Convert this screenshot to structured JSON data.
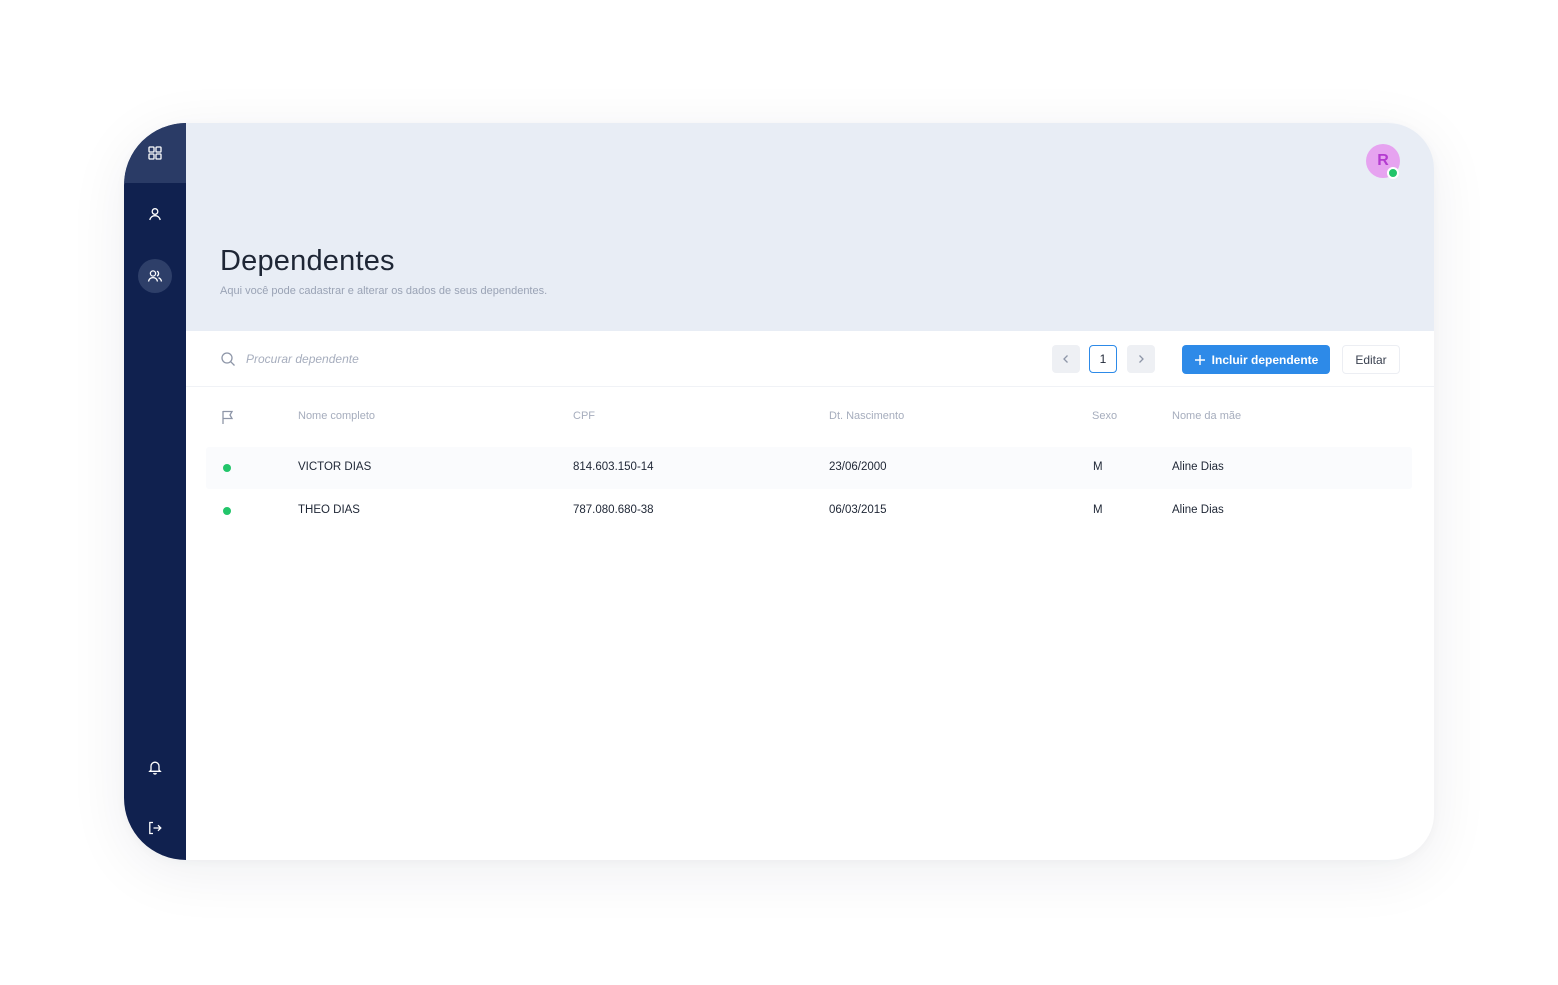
{
  "sidebar": {
    "items": [
      {
        "name": "dashboard",
        "icon": "grid-icon"
      },
      {
        "name": "profile",
        "icon": "user-icon"
      },
      {
        "name": "dependents",
        "icon": "users-icon",
        "active": true
      },
      {
        "name": "notifications",
        "icon": "bell-icon"
      },
      {
        "name": "logout",
        "icon": "logout-icon"
      }
    ]
  },
  "header": {
    "title": "Dependentes",
    "subtitle": "Aqui você pode cadastrar e alterar os dados de seus dependentes.",
    "avatar_initial": "R",
    "avatar_status": "online"
  },
  "toolbar": {
    "search_placeholder": "Procurar dependente",
    "page_current": "1",
    "add_label": "Incluir dependente",
    "edit_label": "Editar"
  },
  "table": {
    "columns": [
      "Nome completo",
      "CPF",
      "Dt. Nascimento",
      "Sexo",
      "Nome da mãe"
    ],
    "rows": [
      {
        "status": "active",
        "name": "VICTOR DIAS",
        "cpf": "814.603.150-14",
        "birth": "23/06/2000",
        "sex": "M",
        "mother": "Aline Dias"
      },
      {
        "status": "active",
        "name": "THEO DIAS",
        "cpf": "787.080.680-38",
        "birth": "06/03/2015",
        "sex": "M",
        "mother": "Aline Dias"
      }
    ]
  },
  "colors": {
    "sidebar": "#10214f",
    "header_bg": "#e8edf5",
    "accent": "#2d8ae8",
    "status_active": "#22c56a",
    "avatar_bg": "#e6a3f0"
  }
}
